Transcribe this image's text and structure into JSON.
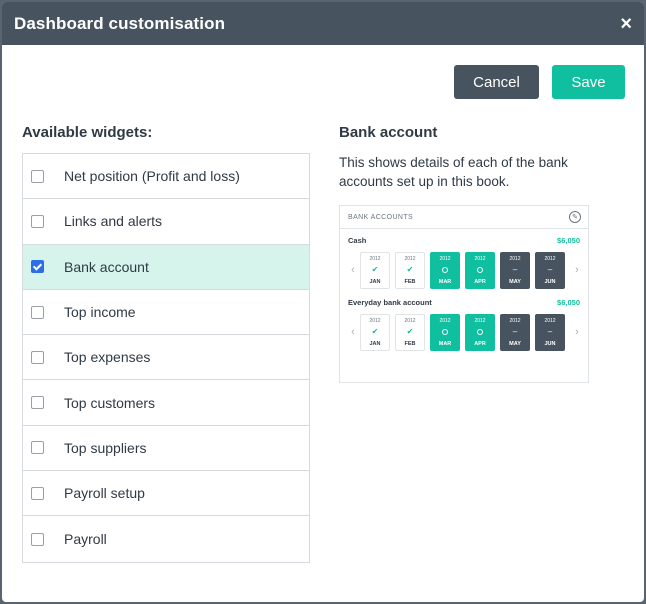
{
  "dialog": {
    "title": "Dashboard customisation",
    "close_glyph": "×",
    "cancel_label": "Cancel",
    "save_label": "Save"
  },
  "widgets": {
    "heading": "Available widgets:",
    "items": [
      {
        "label": "Net position (Profit and loss)",
        "checked": false
      },
      {
        "label": "Links and alerts",
        "checked": false
      },
      {
        "label": "Bank account",
        "checked": true
      },
      {
        "label": "Top income",
        "checked": false
      },
      {
        "label": "Top expenses",
        "checked": false
      },
      {
        "label": "Top customers",
        "checked": false
      },
      {
        "label": "Top suppliers",
        "checked": false
      },
      {
        "label": "Payroll setup",
        "checked": false
      },
      {
        "label": "Payroll",
        "checked": false
      }
    ]
  },
  "detail": {
    "heading": "Bank account",
    "description": "This shows details of each of the bank accounts set up in this book."
  },
  "preview": {
    "title": "BANK ACCOUNTS",
    "gear_icon": "wrench-icon",
    "accounts": [
      {
        "name": "Cash",
        "amount": "$6,050",
        "months": [
          {
            "year": "2012",
            "month": "JAN",
            "status": "done"
          },
          {
            "year": "2012",
            "month": "FEB",
            "status": "done"
          },
          {
            "year": "2012",
            "month": "MAR",
            "status": "current"
          },
          {
            "year": "2012",
            "month": "APR",
            "status": "current"
          },
          {
            "year": "2012",
            "month": "MAY",
            "status": "future"
          },
          {
            "year": "2012",
            "month": "JUN",
            "status": "future"
          }
        ]
      },
      {
        "name": "Everyday bank account",
        "amount": "$6,050",
        "months": [
          {
            "year": "2012",
            "month": "JAN",
            "status": "done"
          },
          {
            "year": "2012",
            "month": "FEB",
            "status": "done"
          },
          {
            "year": "2012",
            "month": "MAR",
            "status": "current"
          },
          {
            "year": "2012",
            "month": "APR",
            "status": "current"
          },
          {
            "year": "2012",
            "month": "MAY",
            "status": "future"
          },
          {
            "year": "2012",
            "month": "JUN",
            "status": "future"
          }
        ]
      }
    ]
  },
  "colors": {
    "header": "#47535f",
    "accent": "#0fbf9f",
    "selected_row": "#d6f4ec"
  }
}
